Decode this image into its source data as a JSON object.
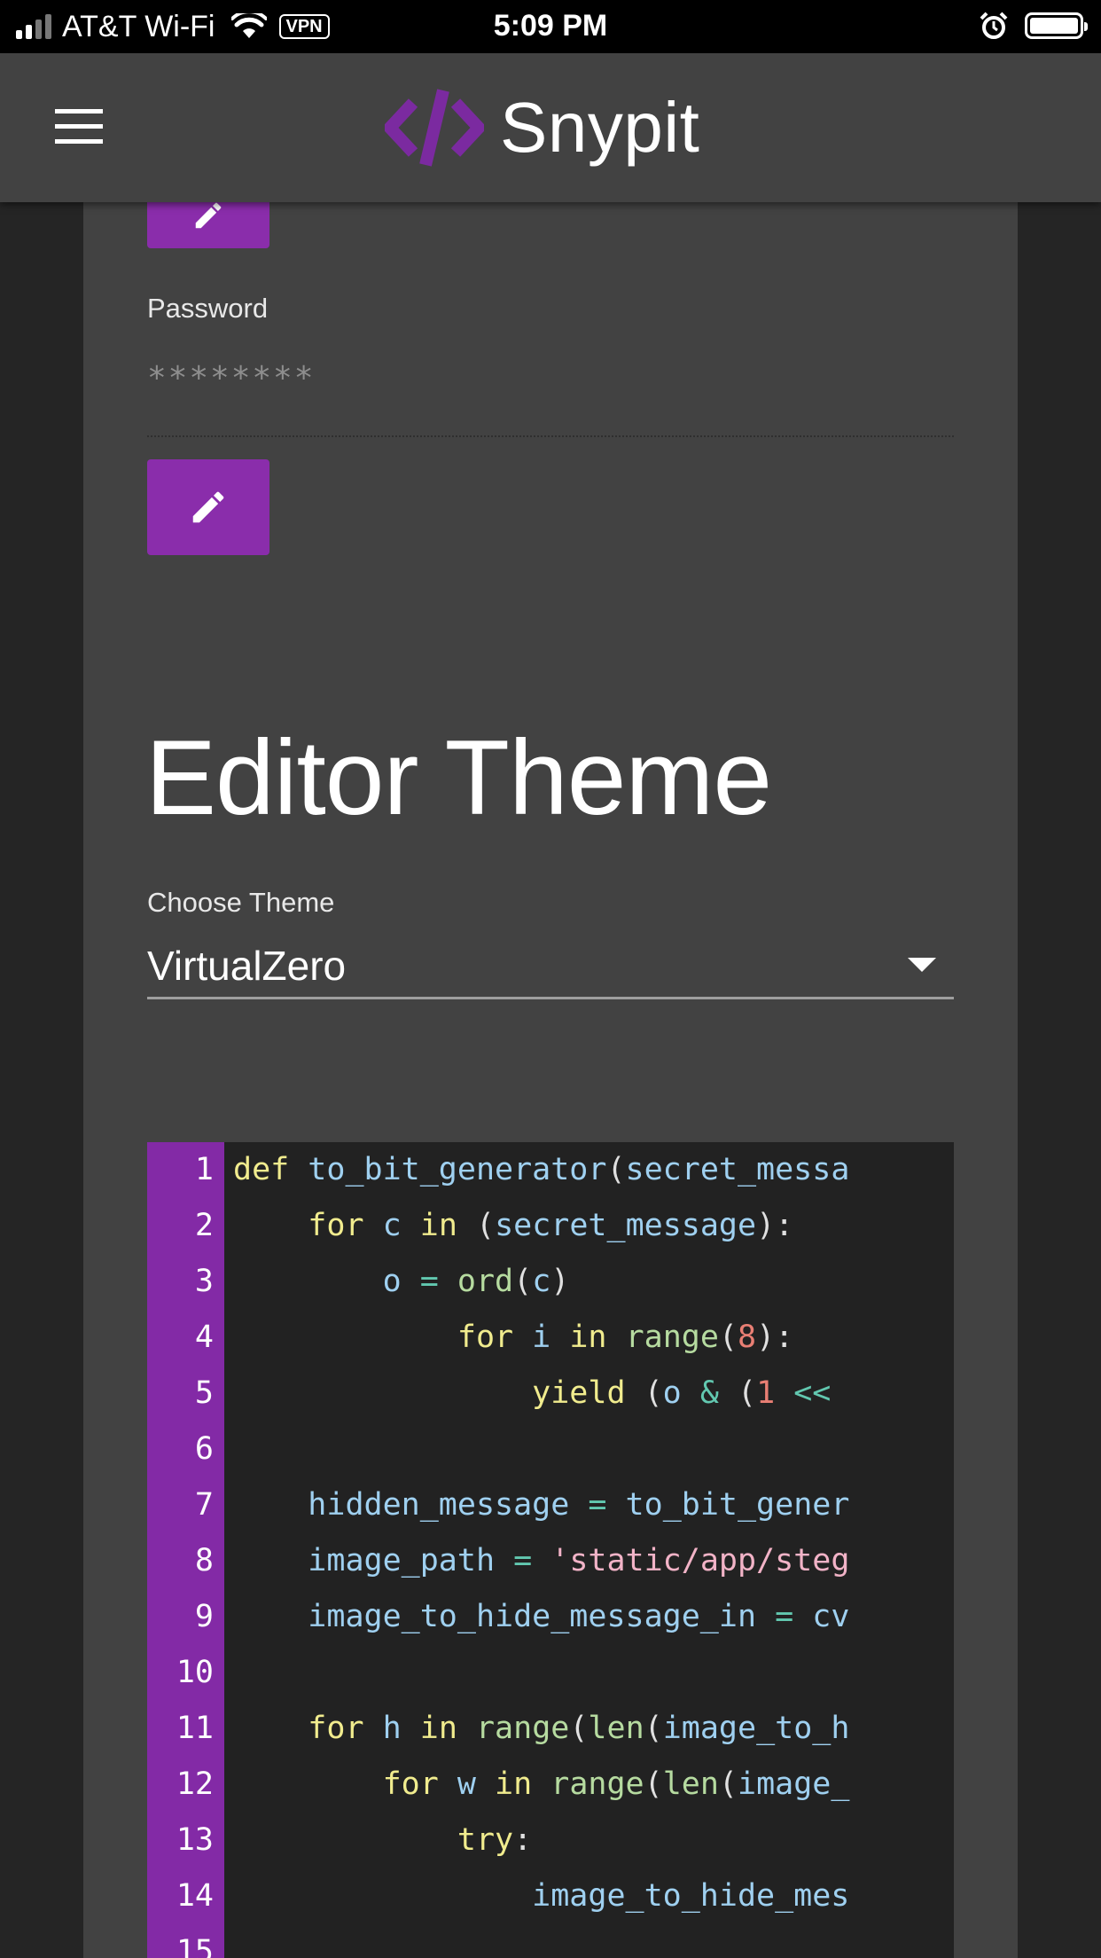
{
  "status_bar": {
    "carrier": "AT&T Wi-Fi",
    "vpn_label": "VPN",
    "time": "5:09 PM"
  },
  "header": {
    "app_name": "Snypit",
    "logo_symbol": "</>",
    "brand_color": "#7b2aa0"
  },
  "account": {
    "password_label": "Password",
    "password_value": "********"
  },
  "editor_theme": {
    "title": "Editor Theme",
    "choose_label": "Choose Theme",
    "selected": "VirtualZero"
  },
  "code_preview": {
    "line_numbers": [
      "1",
      "2",
      "3",
      "4",
      "5",
      "6",
      "7",
      "8",
      "9",
      "10",
      "11",
      "12",
      "13",
      "14",
      "15"
    ],
    "lines": [
      "def to_bit_generator(secret_messa",
      "    for c in (secret_message):",
      "        o = ord(c)",
      "            for i in range(8):",
      "                yield (o & (1 <<",
      "",
      "    hidden_message = to_bit_gener",
      "    image_path = 'static/app/steg",
      "    image_to_hide_message_in = cv",
      "",
      "    for h in range(len(image_to_h",
      "        for w in range(len(image_",
      "            try:",
      "                image_to_hide_mes",
      ""
    ]
  },
  "colors": {
    "accent": "#8a2dab",
    "gutter": "#832aa6",
    "card": "#424242",
    "background": "#252525",
    "editor_bg": "#222222"
  },
  "icons": [
    "menu-icon",
    "pencil-icon",
    "wifi-icon",
    "alarm-icon",
    "battery-icon",
    "dropdown-caret-icon"
  ]
}
